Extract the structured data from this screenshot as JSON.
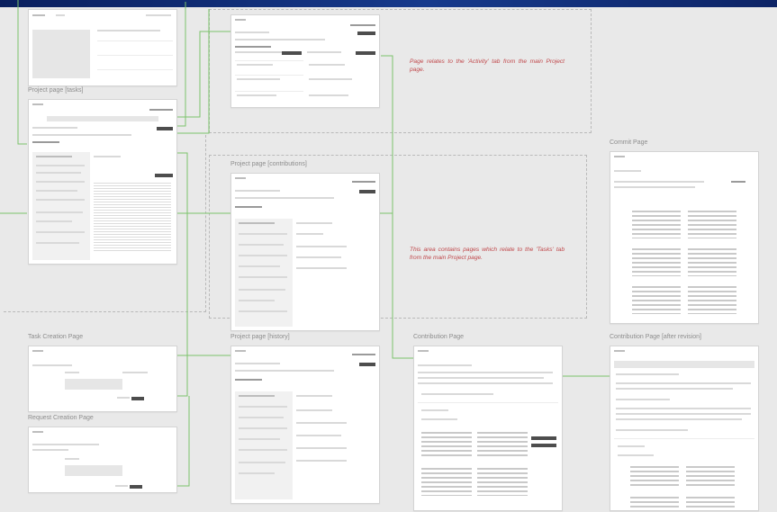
{
  "frames": {
    "project_page_tasks": {
      "label": "Project page [tasks]"
    },
    "project_page_contributions": {
      "label": "Project page [contributions]"
    },
    "project_page_history": {
      "label": "Project page [history]"
    },
    "task_creation_page": {
      "label": "Task Creation Page"
    },
    "request_creation_page": {
      "label": "Request Creation Page"
    },
    "contribution_page": {
      "label": "Contribution Page"
    },
    "contribution_page_after_revision": {
      "label": "Contribution Page [after revision]"
    },
    "commit_page": {
      "label": "Commit Page"
    }
  },
  "notes": {
    "activity": "Page relates to the 'Activity' tab from the main Project page.",
    "tasks": "This area contains pages which relate to the 'Tasks' tab from the main Project page."
  },
  "colors": {
    "connector": "#7cc26b",
    "note": "#c0474a",
    "top_bar": "#0f2a73"
  }
}
